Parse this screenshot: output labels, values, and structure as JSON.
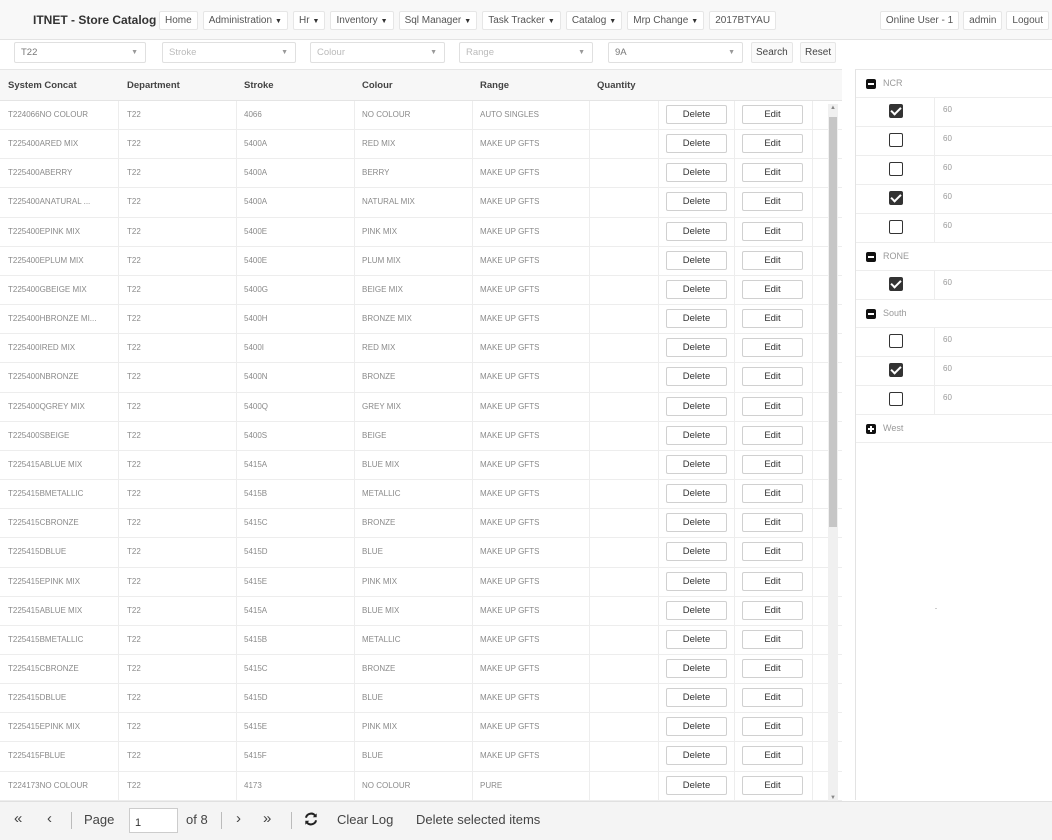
{
  "app": {
    "brand": "ITNET - Store Catalog"
  },
  "nav": {
    "items": [
      {
        "label": "Home",
        "dropdown": false
      },
      {
        "label": "Administration",
        "dropdown": true
      },
      {
        "label": "Hr",
        "dropdown": true
      },
      {
        "label": "Inventory",
        "dropdown": true
      },
      {
        "label": "Sql Manager",
        "dropdown": true
      },
      {
        "label": "Task Tracker",
        "dropdown": true
      },
      {
        "label": "Catalog",
        "dropdown": true
      },
      {
        "label": "Mrp Change",
        "dropdown": true
      },
      {
        "label": "2017BTYAU",
        "dropdown": false
      }
    ],
    "online_users": "Online User - 1",
    "user": "admin",
    "logout": "Logout"
  },
  "filters": {
    "department": {
      "value": "T22"
    },
    "stroke": {
      "placeholder": "Stroke"
    },
    "colour": {
      "placeholder": "Colour"
    },
    "range": {
      "placeholder": "Range"
    },
    "store": {
      "value": "9A"
    },
    "search_label": "Search",
    "reset_label": "Reset"
  },
  "grid": {
    "columns": [
      "System Concat",
      "Department",
      "Stroke",
      "Colour",
      "Range",
      "Quantity"
    ],
    "delete_label": "Delete",
    "edit_label": "Edit",
    "rows": [
      [
        "T224066NO COLOUR",
        "T22",
        "4066",
        "NO COLOUR",
        "AUTO SINGLES",
        ""
      ],
      [
        "T225400ARED MIX",
        "T22",
        "5400A",
        "RED MIX",
        "MAKE UP GFTS",
        ""
      ],
      [
        "T225400ABERRY",
        "T22",
        "5400A",
        "BERRY",
        "MAKE UP GFTS",
        ""
      ],
      [
        "T225400ANATURAL ...",
        "T22",
        "5400A",
        "NATURAL MIX",
        "MAKE UP GFTS",
        ""
      ],
      [
        "T225400EPINK MIX",
        "T22",
        "5400E",
        "PINK MIX",
        "MAKE UP GFTS",
        ""
      ],
      [
        "T225400EPLUM MIX",
        "T22",
        "5400E",
        "PLUM MIX",
        "MAKE UP GFTS",
        ""
      ],
      [
        "T225400GBEIGE MIX",
        "T22",
        "5400G",
        "BEIGE MIX",
        "MAKE UP GFTS",
        ""
      ],
      [
        "T225400HBRONZE MI...",
        "T22",
        "5400H",
        "BRONZE MIX",
        "MAKE UP GFTS",
        ""
      ],
      [
        "T225400IRED MIX",
        "T22",
        "5400I",
        "RED MIX",
        "MAKE UP GFTS",
        ""
      ],
      [
        "T225400NBRONZE",
        "T22",
        "5400N",
        "BRONZE",
        "MAKE UP GFTS",
        ""
      ],
      [
        "T225400QGREY MIX",
        "T22",
        "5400Q",
        "GREY MIX",
        "MAKE UP GFTS",
        ""
      ],
      [
        "T225400SBEIGE",
        "T22",
        "5400S",
        "BEIGE",
        "MAKE UP GFTS",
        ""
      ],
      [
        "T225415ABLUE MIX",
        "T22",
        "5415A",
        "BLUE MIX",
        "MAKE UP GFTS",
        ""
      ],
      [
        "T225415BMETALLIC",
        "T22",
        "5415B",
        "METALLIC",
        "MAKE UP GFTS",
        ""
      ],
      [
        "T225415CBRONZE",
        "T22",
        "5415C",
        "BRONZE",
        "MAKE UP GFTS",
        ""
      ],
      [
        "T225415DBLUE",
        "T22",
        "5415D",
        "BLUE",
        "MAKE UP GFTS",
        ""
      ],
      [
        "T225415EPINK MIX",
        "T22",
        "5415E",
        "PINK MIX",
        "MAKE UP GFTS",
        ""
      ],
      [
        "T225415ABLUE MIX",
        "T22",
        "5415A",
        "BLUE MIX",
        "MAKE UP GFTS",
        ""
      ],
      [
        "T225415BMETALLIC",
        "T22",
        "5415B",
        "METALLIC",
        "MAKE UP GFTS",
        ""
      ],
      [
        "T225415CBRONZE",
        "T22",
        "5415C",
        "BRONZE",
        "MAKE UP GFTS",
        ""
      ],
      [
        "T225415DBLUE",
        "T22",
        "5415D",
        "BLUE",
        "MAKE UP GFTS",
        ""
      ],
      [
        "T225415EPINK MIX",
        "T22",
        "5415E",
        "PINK MIX",
        "MAKE UP GFTS",
        ""
      ],
      [
        "T225415FBLUE",
        "T22",
        "5415F",
        "BLUE",
        "MAKE UP GFTS",
        ""
      ],
      [
        "T224173NO COLOUR",
        "T22",
        "4173",
        "NO COLOUR",
        "PURE",
        ""
      ]
    ]
  },
  "pager": {
    "page_label": "Page",
    "page_value": "1",
    "of_label": "of 8",
    "clear_log": "Clear Log",
    "delete_selected": "Delete selected items"
  },
  "regions": [
    {
      "name": "NCR",
      "expanded": true,
      "items": [
        {
          "checked": true,
          "value": "60"
        },
        {
          "checked": false,
          "value": "60"
        },
        {
          "checked": false,
          "value": "60"
        },
        {
          "checked": true,
          "value": "60"
        },
        {
          "checked": false,
          "value": "60"
        }
      ]
    },
    {
      "name": "RONE",
      "expanded": true,
      "items": [
        {
          "checked": true,
          "value": "60"
        }
      ]
    },
    {
      "name": "South",
      "expanded": true,
      "items": [
        {
          "checked": false,
          "value": "60"
        },
        {
          "checked": true,
          "value": "60"
        },
        {
          "checked": false,
          "value": "60"
        }
      ]
    },
    {
      "name": "West",
      "expanded": false,
      "items": []
    }
  ]
}
